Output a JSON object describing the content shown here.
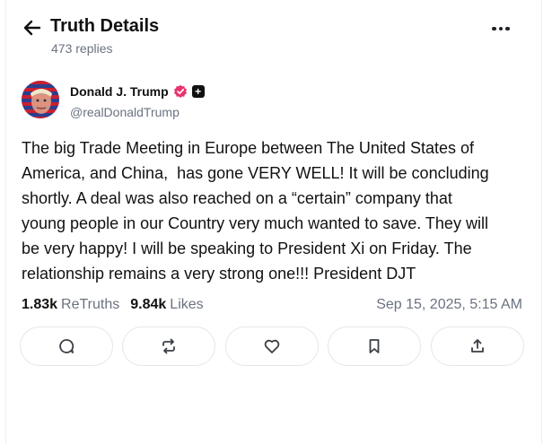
{
  "header": {
    "title": "Truth Details",
    "replies": "473 replies",
    "back_icon": "arrow-left-icon",
    "more_icon": "more-horizontal-icon"
  },
  "author": {
    "name": "Donald J. Trump",
    "handle": "@realDonaldTrump",
    "verified_icon": "verified-badge-icon",
    "plus_badge": "+"
  },
  "post": {
    "text": "The big Trade Meeting in Europe between The United States of\nAmerica, and China,  has gone VERY WELL! It will be concluding\nshortly. A deal was also reached on a “certain” company that\nyoung people in our Country very much wanted to save. They will\nbe very happy! I will be speaking to President Xi on Friday. The\nrelationship remains a very strong one!!! President DJT"
  },
  "stats": {
    "retruths_count": "1.83k",
    "retruths_label": "ReTruths",
    "likes_count": "9.84k",
    "likes_label": "Likes",
    "timestamp": "Sep 15, 2025, 5:15 AM"
  },
  "actions": [
    {
      "name": "reply",
      "icon": "comment-icon"
    },
    {
      "name": "retruth",
      "icon": "repost-icon"
    },
    {
      "name": "like",
      "icon": "heart-icon"
    },
    {
      "name": "bookmark",
      "icon": "bookmark-icon"
    },
    {
      "name": "share",
      "icon": "share-icon"
    }
  ],
  "colors": {
    "text": "#111111",
    "muted": "#6b7280",
    "border": "#e3e6ea",
    "verified": "#e8336d"
  }
}
